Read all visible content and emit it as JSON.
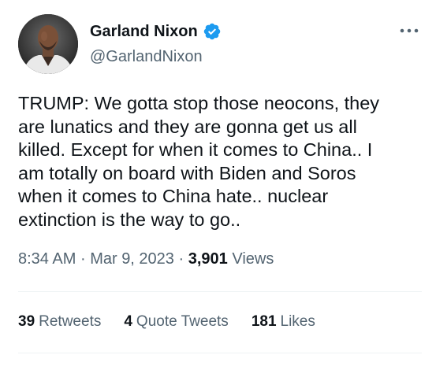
{
  "author": {
    "display_name": "Garland Nixon",
    "handle": "@GarlandNixon",
    "verified_color": "#1d9bf0",
    "avatar_icon": "profile-photo"
  },
  "tweet": {
    "text": "TRUMP: We gotta stop those neocons, they\nare lunatics and they are gonna get us all\nkilled. Except for when it comes to China.. I\nam totally on board with Biden and Soros\nwhen it comes to China hate.. nuclear\nextinction is the way to go..",
    "time": "8:34 AM",
    "separator": "·",
    "date": "Mar 9, 2023",
    "views_count": "3,901",
    "views_label": "Views"
  },
  "stats": {
    "retweets_count": "39",
    "retweets_label": "Retweets",
    "quotes_count": "4",
    "quotes_label": "Quote Tweets",
    "likes_count": "181",
    "likes_label": "Likes"
  },
  "icons": {
    "more": "more-horizontal-icon",
    "verified": "verified-badge-icon"
  }
}
